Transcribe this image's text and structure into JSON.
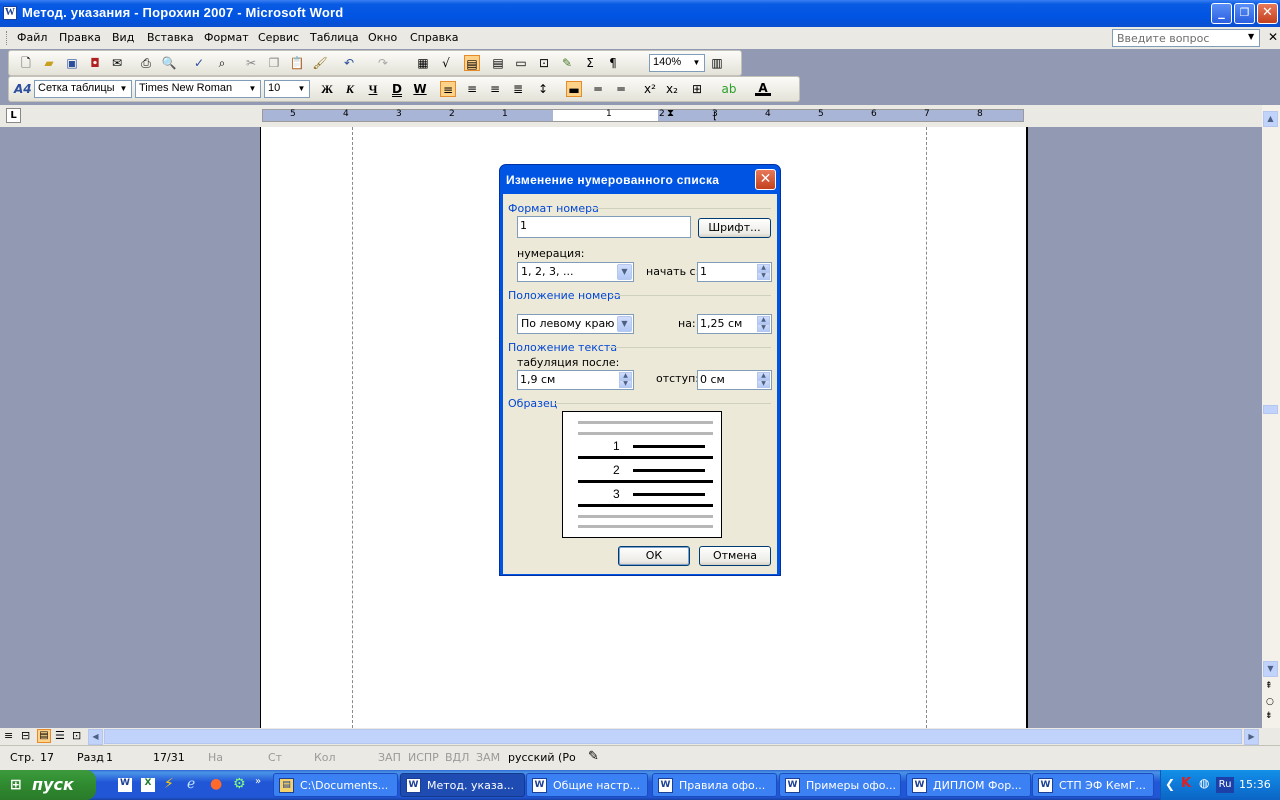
{
  "window": {
    "title": "Метод. указания - Порохин 2007 - Microsoft Word",
    "minimize": "_",
    "maximize": "❐",
    "close": "✕",
    "app_icon": "W"
  },
  "menu": {
    "items": [
      "Файл",
      "Правка",
      "Вид",
      "Вставка",
      "Формат",
      "Сервис",
      "Таблица",
      "Окно",
      "Справка"
    ],
    "ask_placeholder": "Введите вопрос"
  },
  "toolbar_standard": {
    "zoom": "140%"
  },
  "toolbar_formatting": {
    "style": "Сетка таблицы",
    "font": "Times New Roman",
    "size": "10",
    "bold": "Ж",
    "italic": "К",
    "underline": "Ч",
    "double_underline": "D",
    "w_button": "W",
    "style_icon": "A4"
  },
  "ruler": {
    "ticks": [
      "5",
      "4",
      "3",
      "2",
      "1",
      "1",
      "2",
      "3",
      "4",
      "5",
      "6",
      "7",
      "8"
    ],
    "tab_selector": "L"
  },
  "dialog": {
    "title": "Изменение нумерованного списка",
    "close": "✕",
    "section_format": "Формат номера",
    "format_value": "1",
    "font_button": "Шрифт...",
    "numbering_label": "нумерация:",
    "numbering_value": "1, 2, 3, ...",
    "start_label": "начать с:",
    "start_value": "1",
    "section_position": "Положение номера",
    "position_value": "По левому краю",
    "at_label": "на:",
    "at_value": "1,25 см",
    "section_text": "Положение текста",
    "tab_label": "табуляция после:",
    "tab_value": "1,9 см",
    "indent_label": "отступ:",
    "indent_value": "0 см",
    "section_sample": "Образец",
    "sample_numbers": [
      "1",
      "2",
      "3"
    ],
    "ok": "ОК",
    "cancel": "Отмена"
  },
  "statusbar": {
    "page": "Стр.",
    "page_num": "17",
    "section": "Разд",
    "section_num": "1",
    "pages": "17/31",
    "at": "На",
    "line": "Ст",
    "col": "Кол",
    "rec": "ЗАП",
    "trk": "ИСПР",
    "ext": "ВДЛ",
    "ovr": "ЗАМ",
    "language": "русский (Ро"
  },
  "taskbar": {
    "start": "пуск",
    "tasks": [
      {
        "label": "C:\\Documents...",
        "icon": "▤"
      },
      {
        "label": "Метод. указа...",
        "icon": "W"
      },
      {
        "label": "Общие настр...",
        "icon": "W"
      },
      {
        "label": "Правила офо...",
        "icon": "W"
      },
      {
        "label": "Примеры офо...",
        "icon": "W"
      },
      {
        "label": "ДИПЛОМ Фор...",
        "icon": "W"
      },
      {
        "label": "СТП ЭФ КемГ...",
        "icon": "W"
      }
    ],
    "lang": "Ru",
    "clock": "15:36"
  }
}
